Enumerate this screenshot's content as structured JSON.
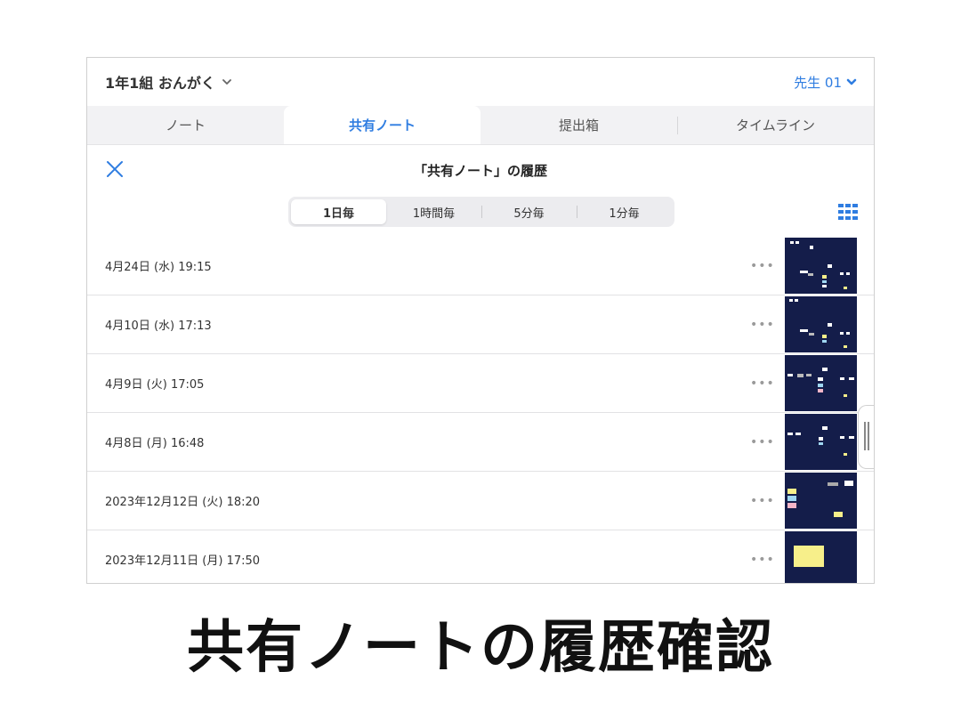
{
  "topbar": {
    "class_name": "1年1組 おんがく",
    "user": "先生 01"
  },
  "tabs": [
    {
      "label": "ノート",
      "active": false
    },
    {
      "label": "共有ノート",
      "active": true
    },
    {
      "label": "提出箱",
      "active": false
    },
    {
      "label": "タイムライン",
      "active": false
    }
  ],
  "history": {
    "title": "「共有ノート」の履歴",
    "intervals": [
      {
        "label": "1日毎",
        "active": true
      },
      {
        "label": "1時間毎",
        "active": false
      },
      {
        "label": "5分毎",
        "active": false
      },
      {
        "label": "1分毎",
        "active": false
      }
    ],
    "entries": [
      {
        "date": "4月24日 (水) 19:15",
        "more": "•••"
      },
      {
        "date": "4月10日 (水) 17:13",
        "more": "•••"
      },
      {
        "date": "4月9日 (火) 17:05",
        "more": "•••"
      },
      {
        "date": "4月8日 (月) 16:48",
        "more": "•••"
      },
      {
        "date": "2023年12月12日 (火) 18:20",
        "more": "•••"
      },
      {
        "date": "2023年12月11日 (月) 17:50",
        "more": "•••"
      }
    ]
  },
  "caption": "共有ノートの履歴確認",
  "colors": {
    "accent": "#2f7de1",
    "thumbnail_bg": "#141d4a",
    "sticky_yellow": "#f7ef8a"
  },
  "icons": {
    "close": "close-icon",
    "grid": "grid-view-icon",
    "chevron": "chevron-down-icon"
  }
}
